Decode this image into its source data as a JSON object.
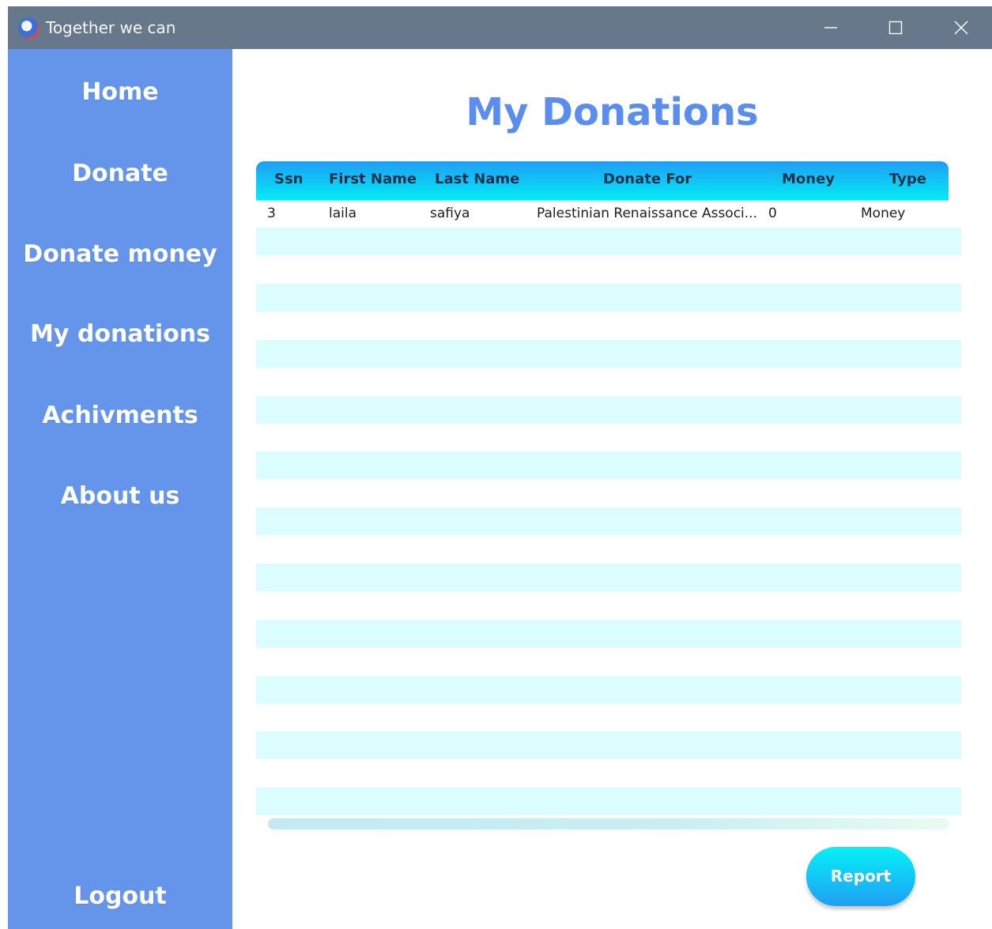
{
  "window": {
    "title": "Together we can",
    "icon": "app-logo-icon",
    "controls": [
      "minimize-icon",
      "maximize-icon",
      "close-icon"
    ]
  },
  "sidebar": {
    "items": [
      {
        "label": "Home"
      },
      {
        "label": "Donate"
      },
      {
        "label": "Donate money"
      },
      {
        "label": "My donations"
      },
      {
        "label": "Achivments"
      },
      {
        "label": "About us"
      }
    ],
    "logout_label": "Logout"
  },
  "main": {
    "title": "My Donations",
    "table": {
      "columns": [
        "Ssn",
        "First Name",
        "Last Name",
        "Donate For",
        "Money",
        "Type"
      ],
      "rows": [
        {
          "ssn": "3",
          "first_name": "laila",
          "last_name": "safiya",
          "donate_for": "Palestinian Renaissance Associ...",
          "money": "0",
          "type": "Money"
        }
      ]
    },
    "report_label": "Report"
  },
  "colors": {
    "sidebar": "#6594eb",
    "titlebar": "#67788b",
    "title_text": "#5b8df0",
    "header_gradient_top": "#1f9df5",
    "header_gradient_bottom": "#03ecf6",
    "row_stripe": "#dcfdfd",
    "button_gradient_top": "#05f2f6",
    "button_gradient_bottom": "#1f9ef4"
  }
}
